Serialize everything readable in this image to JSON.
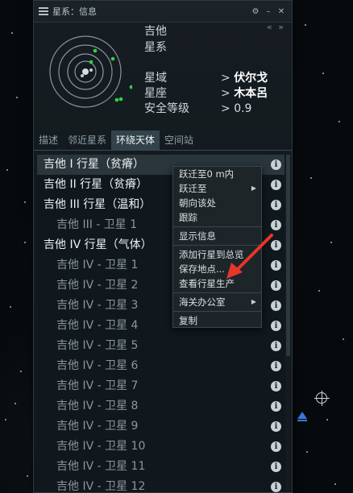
{
  "window": {
    "title": "星系：信息",
    "collapse_glyph": "« »"
  },
  "header": {
    "name": "吉他",
    "type": "星系",
    "region_label": "星域",
    "region_value": "伏尔戈",
    "constellation_label": "星座",
    "constellation_value": "木本呂",
    "security_label": "安全等级",
    "security_value": "0.9",
    "arrow": ">"
  },
  "tabs": [
    {
      "label": "描述",
      "active": false
    },
    {
      "label": "邻近星系",
      "active": false
    },
    {
      "label": "环绕天体",
      "active": true
    },
    {
      "label": "空间站",
      "active": false
    }
  ],
  "list": [
    {
      "label": "吉他 I 行星（贫瘠）",
      "level": 0,
      "selected": true
    },
    {
      "label": "吉他 II 行星（贫瘠）",
      "level": 0
    },
    {
      "label": "吉他 III 行星（温和）",
      "level": 0
    },
    {
      "label": "吉他 III - 卫星 1",
      "level": 1
    },
    {
      "label": "吉他 IV 行星（气体）",
      "level": 0
    },
    {
      "label": "吉他 IV - 卫星 1",
      "level": 1
    },
    {
      "label": "吉他 IV - 卫星 2",
      "level": 1
    },
    {
      "label": "吉他 IV - 卫星 3",
      "level": 1
    },
    {
      "label": "吉他 IV - 卫星 4",
      "level": 1
    },
    {
      "label": "吉他 IV - 卫星 5",
      "level": 1
    },
    {
      "label": "吉他 IV - 卫星 6",
      "level": 1
    },
    {
      "label": "吉他 IV - 卫星 7",
      "level": 1
    },
    {
      "label": "吉他 IV - 卫星 8",
      "level": 1
    },
    {
      "label": "吉他 IV - 卫星 9",
      "level": 1
    },
    {
      "label": "吉他 IV - 卫星 10",
      "level": 1
    },
    {
      "label": "吉他 IV - 卫星 11",
      "level": 1
    },
    {
      "label": "吉他 IV - 卫星 12",
      "level": 1
    }
  ],
  "info_glyph": "i",
  "context_menu": {
    "groups": [
      [
        {
          "label": "跃迁至0 m内"
        },
        {
          "label": "跃迁至",
          "submenu": true
        },
        {
          "label": "朝向该处"
        },
        {
          "label": "跟踪"
        }
      ],
      [
        {
          "label": "显示信息"
        }
      ],
      [
        {
          "label": "添加行星到总览"
        },
        {
          "label": "保存地点..."
        },
        {
          "label": "查看行星生产"
        }
      ],
      [
        {
          "label": "海关办公室",
          "submenu": true
        }
      ],
      [
        {
          "label": "复制"
        }
      ]
    ],
    "submenu_glyph": "▶"
  },
  "colors": {
    "accent_green": "#2fd24a",
    "annotation_red": "#e8352b",
    "nav_blue": "#3a7ad8"
  },
  "icons": [
    "menu-icon",
    "settings-icon",
    "minimize-icon",
    "close-icon",
    "info-icon",
    "submenu-arrow-icon",
    "red-arrow-annotation",
    "target-cursor-icon"
  ]
}
